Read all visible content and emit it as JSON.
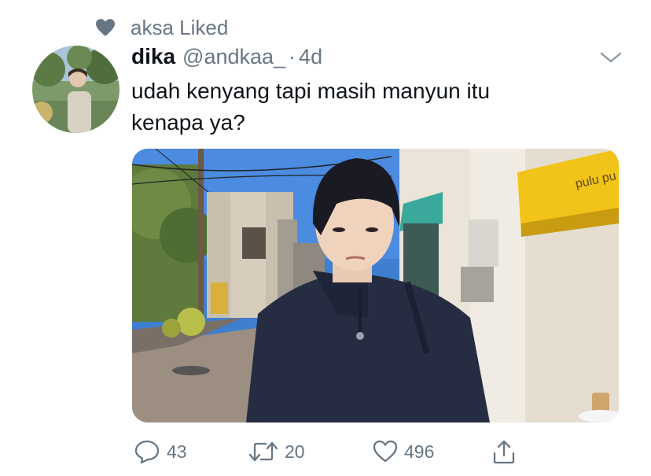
{
  "social_context": {
    "icon": "heart-icon",
    "text": "aksa Liked"
  },
  "author": {
    "display_name": "dika",
    "handle": "@andkaa_",
    "separator": "·",
    "time": "4d"
  },
  "tweet": {
    "line1": "udah kenyang tapi masih manyun itu",
    "line2": "kenapa ya?"
  },
  "media": {
    "awning_text": "pulu pu",
    "alt": "photo"
  },
  "actions": {
    "reply_count": "43",
    "retweet_count": "20",
    "like_count": "496"
  },
  "colors": {
    "text": "#0f1419",
    "secondary": "#687684",
    "awning": "#f2c318"
  }
}
